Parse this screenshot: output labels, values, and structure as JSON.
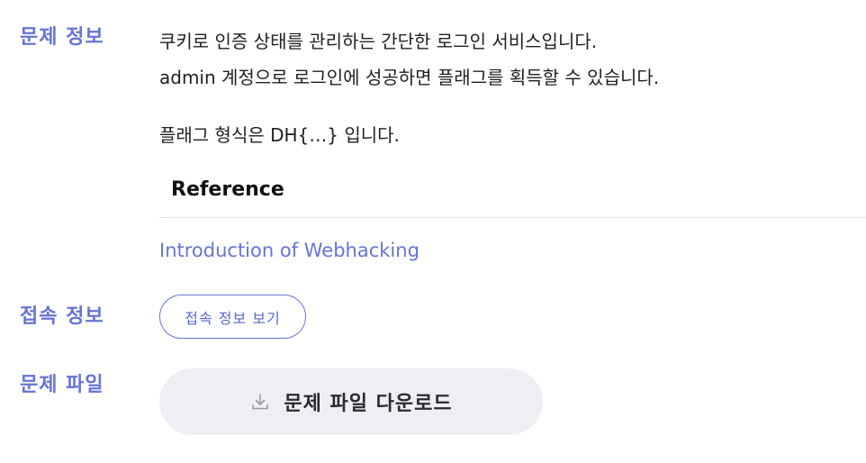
{
  "problem_info": {
    "label": "문제 정보",
    "description_lines": [
      "쿠키로 인증 상태를 관리하는 간단한 로그인 서비스입니다.",
      "admin 계정으로 로그인에 성공하면 플래그를 획득할 수 있습니다."
    ],
    "flag_format": "플래그 형식은 DH{…} 입니다.",
    "reference": {
      "heading": "Reference",
      "link_text": "Introduction of Webhacking"
    }
  },
  "connection_info": {
    "label": "접속 정보",
    "button_label": "접속 정보 보기"
  },
  "problem_file": {
    "label": "문제 파일",
    "button_label": "문제 파일 다운로드",
    "icon": "download-icon"
  },
  "colors": {
    "accent": "#6674d6",
    "text": "#1f1f24",
    "button_bg": "#efeff3",
    "divider": "#e3e3e8"
  }
}
